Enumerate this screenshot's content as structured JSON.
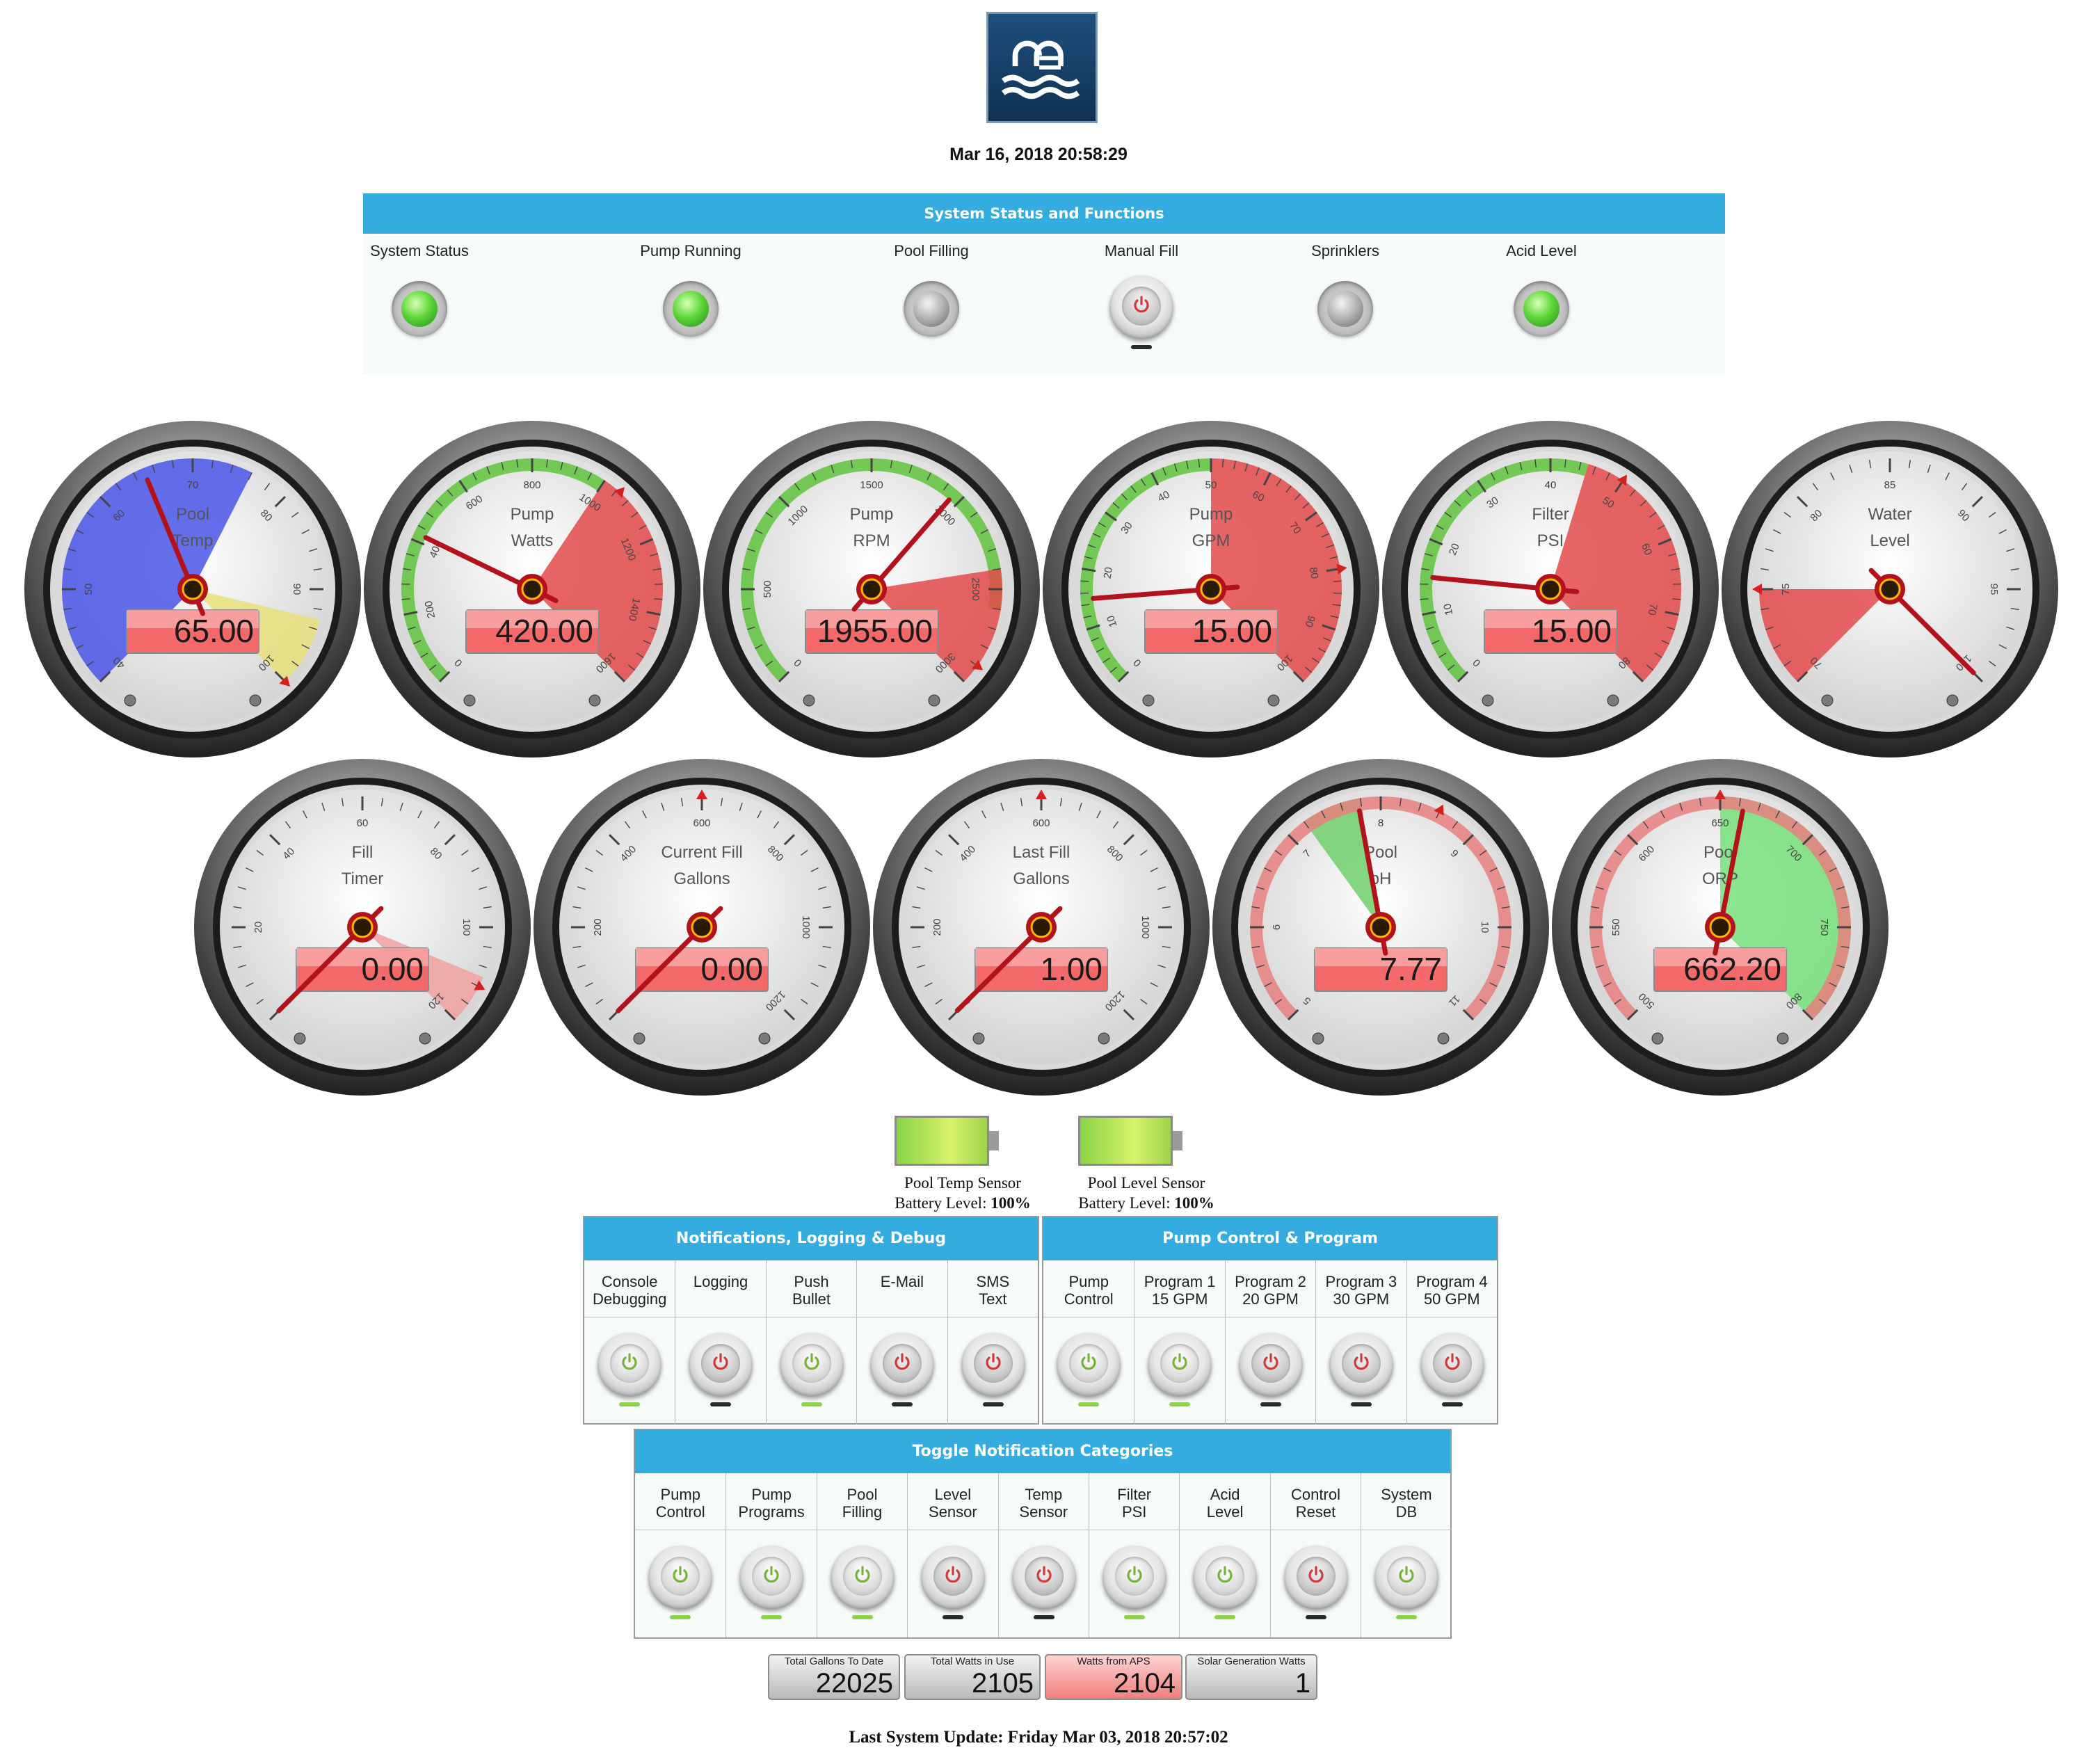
{
  "header": {
    "datetime": "Mar 16, 2018 20:58:29",
    "logo_icon": "pool-icon"
  },
  "status_panel": {
    "title": "System Status and Functions",
    "items": [
      {
        "label": "System Status",
        "state": "green"
      },
      {
        "label": "Pump Running",
        "state": "green"
      },
      {
        "label": "Pool Filling",
        "state": "gray"
      },
      {
        "label": "Manual Fill",
        "state": "power-off"
      },
      {
        "label": "Sprinklers",
        "state": "gray"
      },
      {
        "label": "Acid Level",
        "state": "green"
      }
    ]
  },
  "gauges": [
    {
      "id": "pool-temp",
      "title1": "Pool",
      "title2": "Temp",
      "value_text": "65.00",
      "value": 65,
      "min": 40,
      "max": 100,
      "ticks": [
        "40",
        "50",
        "60",
        "70",
        "80",
        "90",
        "100"
      ],
      "zones": [
        {
          "from": 40,
          "to": 76,
          "color": "#4a55e8"
        },
        {
          "from": 93,
          "to": 100,
          "color": "#e6e07a"
        }
      ],
      "marker": 100
    },
    {
      "id": "pump-watts",
      "title1": "Pump",
      "title2": "Watts",
      "value_text": "420.00",
      "value": 420,
      "min": 0,
      "max": 1600,
      "ticks": [
        "0",
        "200",
        "400",
        "600",
        "800",
        "1000",
        "1200",
        "1400",
        "1600"
      ],
      "zones": [
        {
          "from": 0,
          "to": 1000,
          "color": "#5fc33d",
          "rim": true
        },
        {
          "from": 1000,
          "to": 1600,
          "color": "#e44a4a"
        }
      ],
      "marker": 1050
    },
    {
      "id": "pump-rpm",
      "title1": "Pump",
      "title2": "RPM",
      "value_text": "1955.00",
      "value": 1955,
      "min": 0,
      "max": 3000,
      "ticks": [
        "0",
        "500",
        "1000",
        "1500",
        "2000",
        "2500",
        "3000"
      ],
      "zones": [
        {
          "from": 0,
          "to": 2600,
          "color": "#5fc33d",
          "rim": true
        },
        {
          "from": 2400,
          "to": 3000,
          "color": "#e44a4a"
        }
      ],
      "marker": 2900
    },
    {
      "id": "pump-gpm",
      "title1": "Pump",
      "title2": "GPM",
      "value_text": "15.00",
      "value": 15,
      "min": 0,
      "max": 100,
      "ticks": [
        "0",
        "10",
        "20",
        "30",
        "40",
        "50",
        "60",
        "70",
        "80",
        "90",
        "100"
      ],
      "zones": [
        {
          "from": 0,
          "to": 50,
          "color": "#5fc33d",
          "rim": true
        },
        {
          "from": 50,
          "to": 100,
          "color": "#e44a4a"
        }
      ],
      "marker": 80
    },
    {
      "id": "filter-psi",
      "title1": "Filter",
      "title2": "PSI",
      "value_text": "15.00",
      "value": 15,
      "min": 0,
      "max": 80,
      "ticks": [
        "0",
        "10",
        "20",
        "30",
        "40",
        "50",
        "60",
        "70",
        "80"
      ],
      "zones": [
        {
          "from": 0,
          "to": 45,
          "color": "#5fc33d",
          "rim": true
        },
        {
          "from": 45,
          "to": 80,
          "color": "#e44a4a"
        }
      ],
      "marker": 50
    },
    {
      "id": "water-level",
      "title1": "Water",
      "title2": "Level",
      "value_text": "",
      "value": 100,
      "min": 70,
      "max": 100,
      "ticks": [
        "70",
        "75",
        "80",
        "85",
        "90",
        "95",
        "100"
      ],
      "zones": [
        {
          "from": 70,
          "to": 75,
          "color": "#e44a4a"
        }
      ],
      "marker": 75
    },
    {
      "id": "fill-timer",
      "title1": "Fill",
      "title2": "Timer",
      "value_text": "0.00",
      "value": 0,
      "min": 0,
      "max": 120,
      "ticks": [
        "0",
        "20",
        "40",
        "60",
        "80",
        "100",
        "120"
      ],
      "zones": [
        {
          "from": 110,
          "to": 120,
          "color": "#f1a0a0"
        }
      ],
      "marker": 112
    },
    {
      "id": "current-fill-gallons",
      "title1": "Current Fill",
      "title2": "Gallons",
      "value_text": "0.00",
      "value": 0,
      "min": 0,
      "max": 1200,
      "ticks": [
        "0",
        "200",
        "400",
        "600",
        "800",
        "1000",
        "1200"
      ],
      "zones": [],
      "marker": 600
    },
    {
      "id": "last-fill-gallons",
      "title1": "Last Fill",
      "title2": "Gallons",
      "value_text": "1.00",
      "value": 1,
      "min": 0,
      "max": 1200,
      "ticks": [
        "0",
        "200",
        "400",
        "600",
        "800",
        "1000",
        "1200"
      ],
      "zones": [],
      "marker": 600
    },
    {
      "id": "pool-ph",
      "title1": "Pool",
      "title2": "pH",
      "value_text": "7.77",
      "value": 7.77,
      "min": 5,
      "max": 11,
      "ticks": [
        "5",
        "6",
        "7",
        "8",
        "9",
        "10",
        "11"
      ],
      "zones": [
        {
          "from": 7.2,
          "to": 7.8,
          "color": "#6fd06a"
        },
        {
          "from": 5,
          "to": 11,
          "color": "#e87f7f",
          "rim": true
        }
      ],
      "marker": 8.6
    },
    {
      "id": "pool-orp",
      "title1": "Pool",
      "title2": "ORP",
      "value_text": "662.20",
      "value": 662.2,
      "min": 500,
      "max": 800,
      "ticks": [
        "500",
        "550",
        "600",
        "650",
        "700",
        "750",
        "800"
      ],
      "zones": [
        {
          "from": 650,
          "to": 800,
          "color": "#76e07a"
        },
        {
          "from": 500,
          "to": 800,
          "color": "#e87f7f",
          "rim": true
        }
      ],
      "marker": 650
    }
  ],
  "batteries": [
    {
      "line1": "Pool Temp Sensor",
      "line2_prefix": "Battery Level: ",
      "level": "100%",
      "level_fraction": 1.0
    },
    {
      "line1": "Pool Level Sensor",
      "line2_prefix": "Battery Level: ",
      "level": "100%",
      "level_fraction": 1.0
    }
  ],
  "notifications_table": {
    "title": "Notifications, Logging & Debug",
    "columns": [
      {
        "line1": "Console",
        "line2": "Debugging",
        "state": "on"
      },
      {
        "line1": "Logging",
        "line2": "",
        "state": "off"
      },
      {
        "line1": "Push",
        "line2": "Bullet",
        "state": "on"
      },
      {
        "line1": "E-Mail",
        "line2": "",
        "state": "off"
      },
      {
        "line1": "SMS",
        "line2": "Text",
        "state": "off"
      }
    ]
  },
  "pump_table": {
    "title": "Pump Control & Program",
    "columns": [
      {
        "line1": "Pump",
        "line2": "Control",
        "state": "on"
      },
      {
        "line1": "Program 1",
        "line2": "15 GPM",
        "state": "on"
      },
      {
        "line1": "Program 2",
        "line2": "20 GPM",
        "state": "off"
      },
      {
        "line1": "Program 3",
        "line2": "30 GPM",
        "state": "off"
      },
      {
        "line1": "Program 4",
        "line2": "50 GPM",
        "state": "off"
      }
    ]
  },
  "toggle_table": {
    "title": "Toggle Notification Categories",
    "columns": [
      {
        "line1": "Pump",
        "line2": "Control",
        "state": "on"
      },
      {
        "line1": "Pump",
        "line2": "Programs",
        "state": "on"
      },
      {
        "line1": "Pool",
        "line2": "Filling",
        "state": "on"
      },
      {
        "line1": "Level",
        "line2": "Sensor",
        "state": "off"
      },
      {
        "line1": "Temp",
        "line2": "Sensor",
        "state": "off"
      },
      {
        "line1": "Filter",
        "line2": "PSI",
        "state": "on"
      },
      {
        "line1": "Acid",
        "line2": "Level",
        "state": "on"
      },
      {
        "line1": "Control",
        "line2": "Reset",
        "state": "off"
      },
      {
        "line1": "System",
        "line2": "DB",
        "state": "on"
      }
    ]
  },
  "counters": [
    {
      "label": "Total Gallons To Date",
      "value": "22025",
      "style": "gray"
    },
    {
      "label": "Total Watts in Use",
      "value": "2105",
      "style": "gray"
    },
    {
      "label": "Watts from APS",
      "value": "2104",
      "style": "red"
    },
    {
      "label": "Solar Generation Watts",
      "value": "1",
      "style": "gray"
    }
  ],
  "footer": {
    "last_update": "Last System Update: Friday Mar 03, 2018 20:57:02"
  },
  "colors": {
    "header_blue": "#34ace0",
    "on_green": "#8bd44a",
    "off_red": "#d23a3a"
  }
}
